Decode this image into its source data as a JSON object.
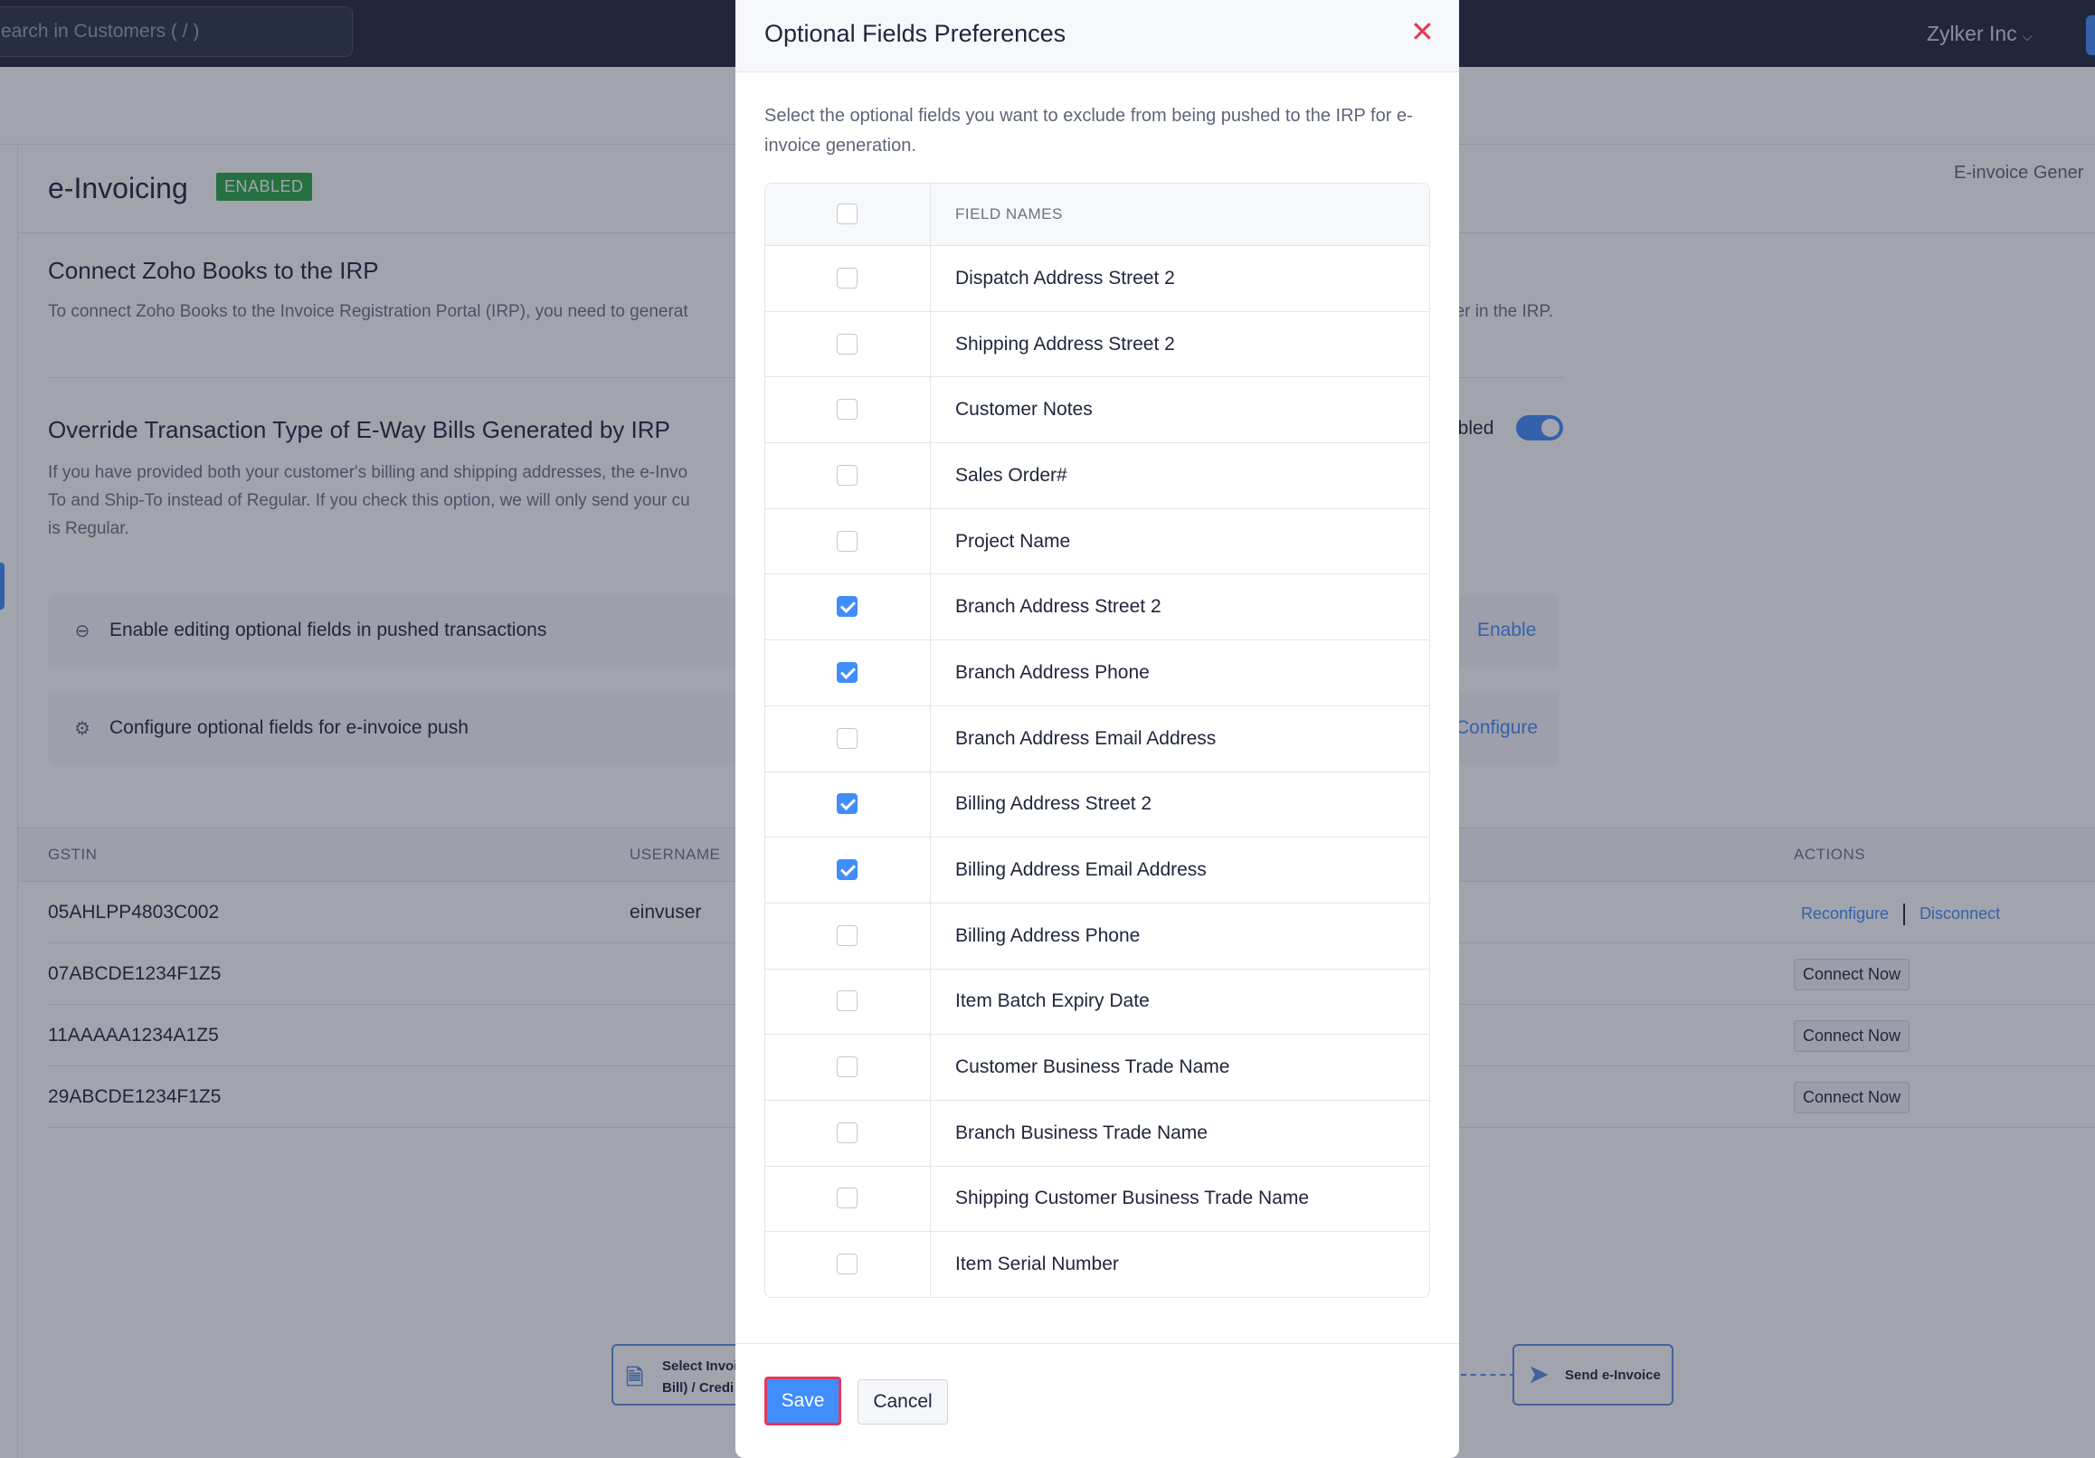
{
  "topbar": {
    "search_placeholder": "earch in Customers ( / )",
    "org_name": "Zylker Inc"
  },
  "page": {
    "title": "e-Invoicing",
    "status_badge": "ENABLED",
    "right_link": "E-invoice Gener"
  },
  "connect_section": {
    "title": "Connect Zoho Books to the IRP",
    "text_left": "To connect Zoho Books to the Invoice Registration Portal (IRP), you need to generat",
    "text_right": "der in the IRP."
  },
  "override_section": {
    "title": "Override Transaction Type of E-Way Bills Generated by IRP",
    "text_lines": [
      "If you have provided both your customer's billing and shipping addresses, the e-Invo",
      "To and Ship-To instead of Regular. If you check this option, we will only send your cu",
      "is Regular."
    ],
    "toggle_label": "abled"
  },
  "option_cards": [
    {
      "text": "Enable editing optional fields in pushed transactions",
      "action": "Enable",
      "icon": "toggle-off-icon"
    },
    {
      "text": "Configure optional fields for e-invoice push",
      "action": "Configure",
      "icon": "gear-icon"
    }
  ],
  "gstin_table": {
    "headers": {
      "gstin": "GSTIN",
      "username": "USERNAME",
      "actions": "ACTIONS"
    },
    "rows": [
      {
        "gstin": "05AHLPP4803C002",
        "username": "einvuser",
        "reconfigure": "Reconfigure",
        "disconnect": "Disconnect"
      },
      {
        "gstin": "07ABCDE1234F1Z5",
        "connect": "Connect Now"
      },
      {
        "gstin": "11AAAAA1234A1Z5",
        "connect": "Connect Now"
      },
      {
        "gstin": "29ABCDE1234F1Z5",
        "connect": "Connect Now"
      }
    ]
  },
  "flow": {
    "step1_line1": "Select Invoi",
    "step1_line2": "Bill) / Credi",
    "step_last": "Send e-Invoice"
  },
  "modal": {
    "title": "Optional Fields Preferences",
    "close_glyph": "✕",
    "description": "Select the optional fields you want to exclude from being pushed to the IRP for e-invoice generation.",
    "column_header": "FIELD NAMES",
    "select_all_checked": false,
    "fields": [
      {
        "name": "Dispatch Address Street 2",
        "checked": false
      },
      {
        "name": "Shipping Address Street 2",
        "checked": false
      },
      {
        "name": "Customer Notes",
        "checked": false
      },
      {
        "name": "Sales Order#",
        "checked": false
      },
      {
        "name": "Project Name",
        "checked": false
      },
      {
        "name": "Branch Address Street 2",
        "checked": true
      },
      {
        "name": "Branch Address Phone",
        "checked": true
      },
      {
        "name": "Branch Address Email Address",
        "checked": false
      },
      {
        "name": "Billing Address Street 2",
        "checked": true
      },
      {
        "name": "Billing Address Email Address",
        "checked": true
      },
      {
        "name": "Billing Address Phone",
        "checked": false
      },
      {
        "name": "Item Batch Expiry Date",
        "checked": false
      },
      {
        "name": "Customer Business Trade Name",
        "checked": false
      },
      {
        "name": "Branch Business Trade Name",
        "checked": false
      },
      {
        "name": "Shipping Customer Business Trade Name",
        "checked": false
      },
      {
        "name": "Item Serial Number",
        "checked": false
      }
    ],
    "save_label": "Save",
    "cancel_label": "Cancel"
  },
  "colors": {
    "accent": "#408dfb",
    "topbar": "#21263c",
    "badge": "#29a745",
    "close": "#e5385c"
  }
}
